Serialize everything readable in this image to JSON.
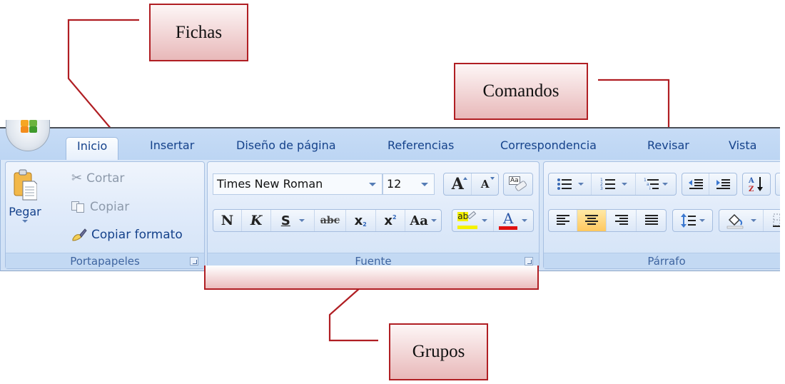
{
  "callouts": {
    "tabs": "Fichas",
    "commands": "Comandos",
    "groups": "Grupos"
  },
  "ribbon": {
    "office_button": "office-logo",
    "tabs": [
      {
        "label": "Inicio",
        "active": true
      },
      {
        "label": "Insertar",
        "active": false
      },
      {
        "label": "Diseño de página",
        "active": false
      },
      {
        "label": "Referencias",
        "active": false
      },
      {
        "label": "Correspondencia",
        "active": false
      },
      {
        "label": "Revisar",
        "active": false
      },
      {
        "label": "Vista",
        "active": false
      }
    ],
    "groups": {
      "clipboard": {
        "label": "Portapapeles",
        "paste": "Pegar",
        "cut": "Cortar",
        "copy": "Copiar",
        "format_painter": "Copiar formato"
      },
      "font": {
        "label": "Fuente",
        "font_name": "Times New Roman",
        "font_size": "12",
        "grow_font": "A",
        "shrink_font": "A",
        "clear_format": "Aa",
        "bold": "N",
        "italic": "K",
        "underline": "S",
        "strikethrough": "abc",
        "subscript": "x",
        "subscript_mark": "2",
        "superscript": "x",
        "superscript_mark": "2",
        "change_case": "Aa",
        "highlight": "ab",
        "font_color": "A",
        "highlight_color": "#f5f200",
        "font_color_bar": "#e01010"
      },
      "paragraph": {
        "label": "Párrafo",
        "sort": "A Z",
        "active_alignment": "center"
      }
    }
  },
  "colors": {
    "callout_border": "#b01e23",
    "tab_text": "#15428b",
    "active_button": "#ffc85f"
  }
}
